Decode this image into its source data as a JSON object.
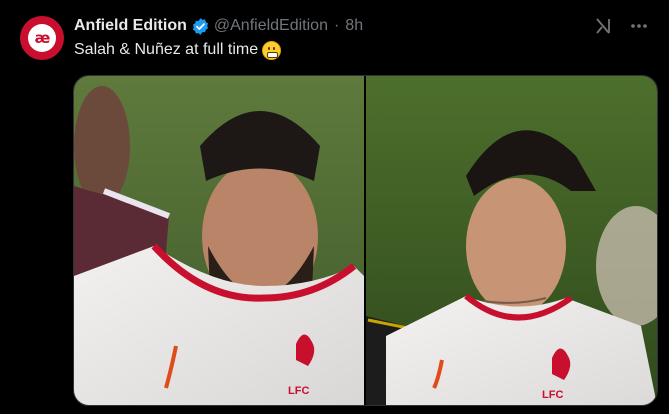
{
  "tweet": {
    "avatar": {
      "logo_text": "æ",
      "color": "#c8102e"
    },
    "author_name": "Anfield Edition",
    "verified": true,
    "handle": "@AnfieldEdition",
    "separator": "·",
    "time": "8h",
    "text": "Salah & Nuñez at full time",
    "emoji": "grimacing-face"
  },
  "top_icons": {
    "grok": "grok-icon",
    "more": "more-icon"
  },
  "media": {
    "photos": [
      {
        "subject": "player-left",
        "crest_text": "LFC"
      },
      {
        "subject": "player-right",
        "crest_text": "LFC"
      }
    ]
  },
  "colors": {
    "background": "#000000",
    "text_primary": "#e7e9ea",
    "text_secondary": "#71767b",
    "verified_blue": "#1d9bf0",
    "brand_red": "#c8102e"
  }
}
